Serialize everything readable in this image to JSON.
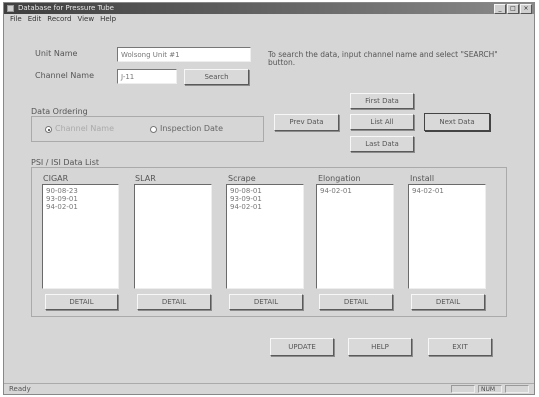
{
  "window": {
    "title": "Database for Pressure Tube",
    "controls": {
      "minimize": "_",
      "maximize": "□",
      "close": "×"
    }
  },
  "menu": [
    "File",
    "Edit",
    "Record",
    "View",
    "Help"
  ],
  "unit": {
    "label": "Unit Name",
    "value": "Wolsong Unit #1"
  },
  "channel": {
    "label": "Channel Name",
    "value": "J-11",
    "search_label": "Search"
  },
  "hint": "To search the data, input channel name and select \"SEARCH\" button.",
  "ordering": {
    "label": "Data Ordering",
    "options": [
      "Channel Name",
      "Inspection Date"
    ],
    "selected": "Channel Name"
  },
  "nav": {
    "first": "First Data",
    "prev": "Prev Data",
    "list_all": "List All",
    "next": "Next Data",
    "last": "Last Data"
  },
  "list_section": {
    "label": "PSI / ISI Data List"
  },
  "lists": [
    {
      "title": "CIGAR",
      "items": [
        "90-08-23",
        "93-09-01",
        "94-02-01"
      ],
      "detail": "DETAIL"
    },
    {
      "title": "SLAR",
      "items": [],
      "detail": "DETAIL"
    },
    {
      "title": "Scrape",
      "items": [
        "90-08-01",
        "93-09-01",
        "94-02-01"
      ],
      "detail": "DETAIL"
    },
    {
      "title": "Elongation",
      "items": [
        "94-02-01"
      ],
      "detail": "DETAIL"
    },
    {
      "title": "Install",
      "items": [
        "94-02-01"
      ],
      "detail": "DETAIL"
    }
  ],
  "actions": {
    "update": "UPDATE",
    "help": "HELP",
    "exit": "EXIT"
  },
  "status": {
    "text": "Ready",
    "panel_num": "NUM"
  }
}
